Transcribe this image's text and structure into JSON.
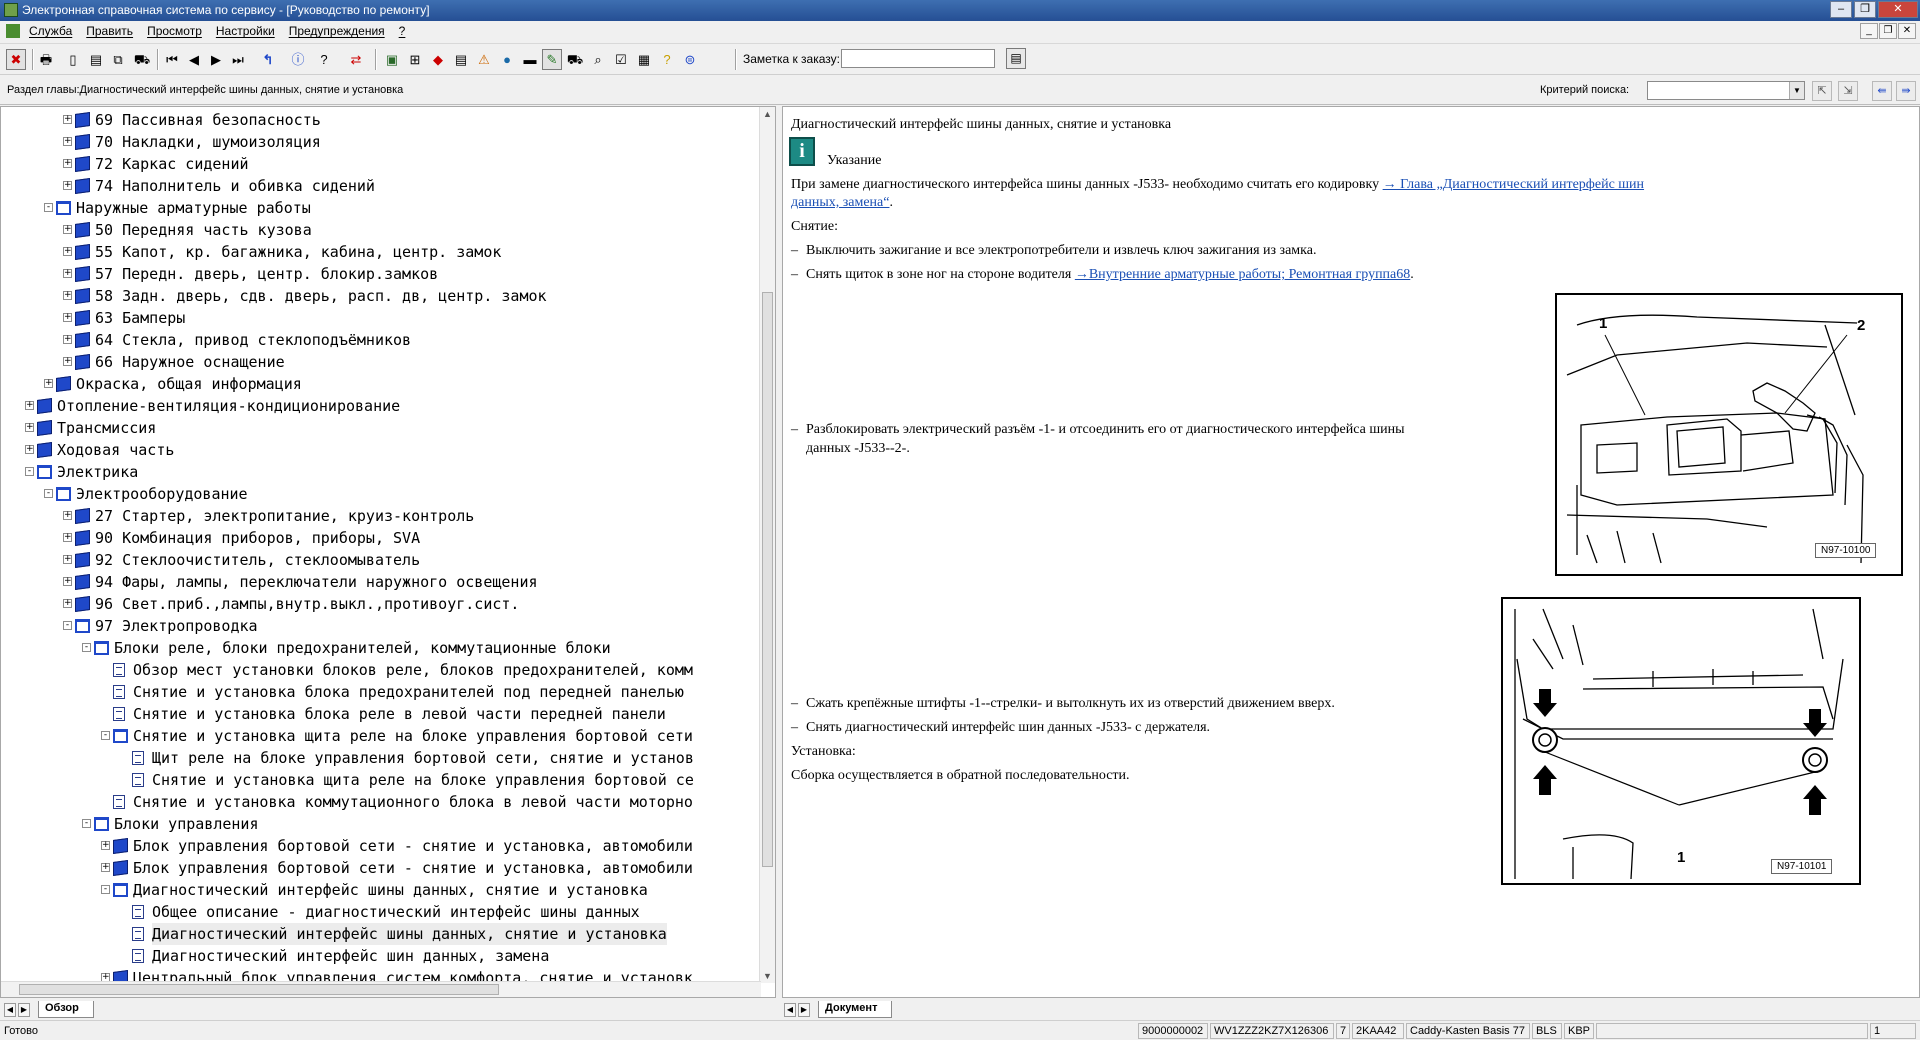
{
  "window": {
    "title": "Электронная справочная система по сервису - [Руководство по ремонту]"
  },
  "menu": [
    "Служба",
    "Править",
    "Просмотр",
    "Настройки",
    "Предупреждения",
    "?"
  ],
  "toolbar": {
    "order_label": "Заметка к заказу:",
    "order_value": ""
  },
  "infobar": {
    "section": "Раздел главы:Диагностический интерфейс шины данных, снятие и установка",
    "criteria_label": "Критерий  поиска:",
    "criteria_value": ""
  },
  "tree": [
    {
      "text": "69 Пассивная безопасность",
      "level": 3,
      "icon": "book",
      "expander": "+"
    },
    {
      "text": "70 Накладки, шумоизоляция",
      "level": 3,
      "icon": "book",
      "expander": "+"
    },
    {
      "text": "72 Каркас сидений",
      "level": 3,
      "icon": "book",
      "expander": "+"
    },
    {
      "text": "74 Наполнитель и обивка сидений",
      "level": 3,
      "icon": "book",
      "expander": "+"
    },
    {
      "text": "Наружные арматурные работы",
      "level": 2,
      "icon": "open",
      "expander": "-"
    },
    {
      "text": "50 Передняя часть кузова",
      "level": 3,
      "icon": "book",
      "expander": "+"
    },
    {
      "text": "55 Капот, кр. багажника, кабина, центр. замок",
      "level": 3,
      "icon": "book",
      "expander": "+"
    },
    {
      "text": "57 Передн. дверь, центр. блокир.замков",
      "level": 3,
      "icon": "book",
      "expander": "+"
    },
    {
      "text": "58 Задн. дверь, сдв. дверь, расп. дв, центр. замок",
      "level": 3,
      "icon": "book",
      "expander": "+"
    },
    {
      "text": "63 Бамперы",
      "level": 3,
      "icon": "book",
      "expander": "+"
    },
    {
      "text": "64 Стекла, привод стеклоподъёмников",
      "level": 3,
      "icon": "book",
      "expander": "+"
    },
    {
      "text": "66 Наружное оснащение",
      "level": 3,
      "icon": "book",
      "expander": "+"
    },
    {
      "text": "Окраска, общая информация",
      "level": 2,
      "icon": "book",
      "expander": "+"
    },
    {
      "text": "Отопление-вентиляция-кондиционирование",
      "level": 1,
      "icon": "book",
      "expander": "+"
    },
    {
      "text": "Трансмиссия",
      "level": 1,
      "icon": "book",
      "expander": "+"
    },
    {
      "text": "Ходовая часть",
      "level": 1,
      "icon": "book",
      "expander": "+"
    },
    {
      "text": "Электрика",
      "level": 1,
      "icon": "open",
      "expander": "-"
    },
    {
      "text": "Электрооборудование",
      "level": 2,
      "icon": "open",
      "expander": "-"
    },
    {
      "text": "27 Стартер, электропитание, круиз-контроль",
      "level": 3,
      "icon": "book",
      "expander": "+"
    },
    {
      "text": "90 Комбинация приборов, приборы, SVA",
      "level": 3,
      "icon": "book",
      "expander": "+"
    },
    {
      "text": "92 Стеклоочиститель, стеклоомыватель",
      "level": 3,
      "icon": "book",
      "expander": "+"
    },
    {
      "text": "94 Фары, лампы, переключатели наружного освещения",
      "level": 3,
      "icon": "book",
      "expander": "+"
    },
    {
      "text": "96 Свет.приб.,лампы,внутр.выкл.,противоуг.сист.",
      "level": 3,
      "icon": "book",
      "expander": "+"
    },
    {
      "text": "97 Электропроводка",
      "level": 3,
      "icon": "open",
      "expander": "-"
    },
    {
      "text": "Блоки реле, блоки предохранителей, коммутационные блоки",
      "level": 4,
      "icon": "open",
      "expander": "-"
    },
    {
      "text": "Обзор мест установки блоков реле, блоков предохранителей, комм",
      "level": 5,
      "icon": "page",
      "expander": ""
    },
    {
      "text": "Снятие и установка блока предохранителей под передней панелью",
      "level": 5,
      "icon": "page",
      "expander": ""
    },
    {
      "text": "Снятие и установка блока реле в левой части передней панели",
      "level": 5,
      "icon": "page",
      "expander": ""
    },
    {
      "text": "Снятие и установка щита реле на блоке управления бортовой сети",
      "level": 5,
      "icon": "open",
      "expander": "-"
    },
    {
      "text": "Щит реле на блоке управления бортовой сети, снятие и установ",
      "level": 6,
      "icon": "page",
      "expander": ""
    },
    {
      "text": "Снятие и установка щита реле на блоке управления бортовой се",
      "level": 6,
      "icon": "page",
      "expander": ""
    },
    {
      "text": "Снятие и установка коммутационного блока в левой части моторно",
      "level": 5,
      "icon": "page",
      "expander": ""
    },
    {
      "text": "Блоки управления",
      "level": 4,
      "icon": "open",
      "expander": "-"
    },
    {
      "text": "Блок управления бортовой сети - снятие и установка, автомобили",
      "level": 5,
      "icon": "book",
      "expander": "+"
    },
    {
      "text": "Блок управления бортовой сети - снятие и установка, автомобили",
      "level": 5,
      "icon": "book",
      "expander": "+"
    },
    {
      "text": "Диагностический интерфейс шины данных, снятие и установка",
      "level": 5,
      "icon": "open",
      "expander": "-"
    },
    {
      "text": "Общее описание - диагностический интерфейс шины данных",
      "level": 6,
      "icon": "page",
      "expander": ""
    },
    {
      "text": "Диагностический интерфейс шины данных, снятие и установка",
      "level": 6,
      "icon": "page",
      "expander": "",
      "selected": true
    },
    {
      "text": "Диагностический интерфейс шин данных, замена",
      "level": 6,
      "icon": "page",
      "expander": ""
    },
    {
      "text": "Центральный блок управления систем комфорта, снятие и установк",
      "level": 5,
      "icon": "book",
      "expander": "+"
    }
  ],
  "left_tab": "Обзор",
  "right_tab": "Документ",
  "doc": {
    "title": "Диагностический интерфейс шины данных, снятие и установка",
    "note_label": "Указание",
    "note_text_a": "При замене диагностического интерфейса шины данных -J533- необходимо считать его кодировку ",
    "note_link_a": "→ Глава „Диагностический интерфейс шин",
    "note_link_b": "данных, замена“",
    "note_text_b": ".",
    "removal_label": "Снятие:",
    "step1": "Выключить зажигание и все электропотребители и извлечь ключ зажигания из замка.",
    "step2_text": "Снять щиток в зоне ног на стороне водителя ",
    "step2_link": "→Внутренние арматурные работы; Ремонтная группа68",
    "step2_end": ".",
    "step3_a": "Разблокировать электрический разъём -1- и отсоединить его от диагностического интерфейса шины",
    "step3_b": "данных -J533--2-.",
    "step4": "Сжать крепёжные штифты -1--стрелки- и вытолкнуть их из отверстий движением вверх.",
    "step5": "Снять диагностический интерфейс шин данных -J533- с держателя.",
    "install_label": "Установка:",
    "install_text": "Сборка осуществляется в обратной последовательности.",
    "fig1_id": "N97-10100",
    "fig1_label1": "1",
    "fig1_label2": "2",
    "fig2_id": "N97-10101",
    "fig2_label1": "1",
    "dash": "–"
  },
  "status": {
    "ready": "Готово",
    "cells": [
      "9000000002",
      "WV1ZZZ2KZ7X126306",
      "7",
      "2KAA42",
      "Caddy-Kasten Basis 77",
      "BLS",
      "KBP",
      "",
      "1"
    ]
  }
}
